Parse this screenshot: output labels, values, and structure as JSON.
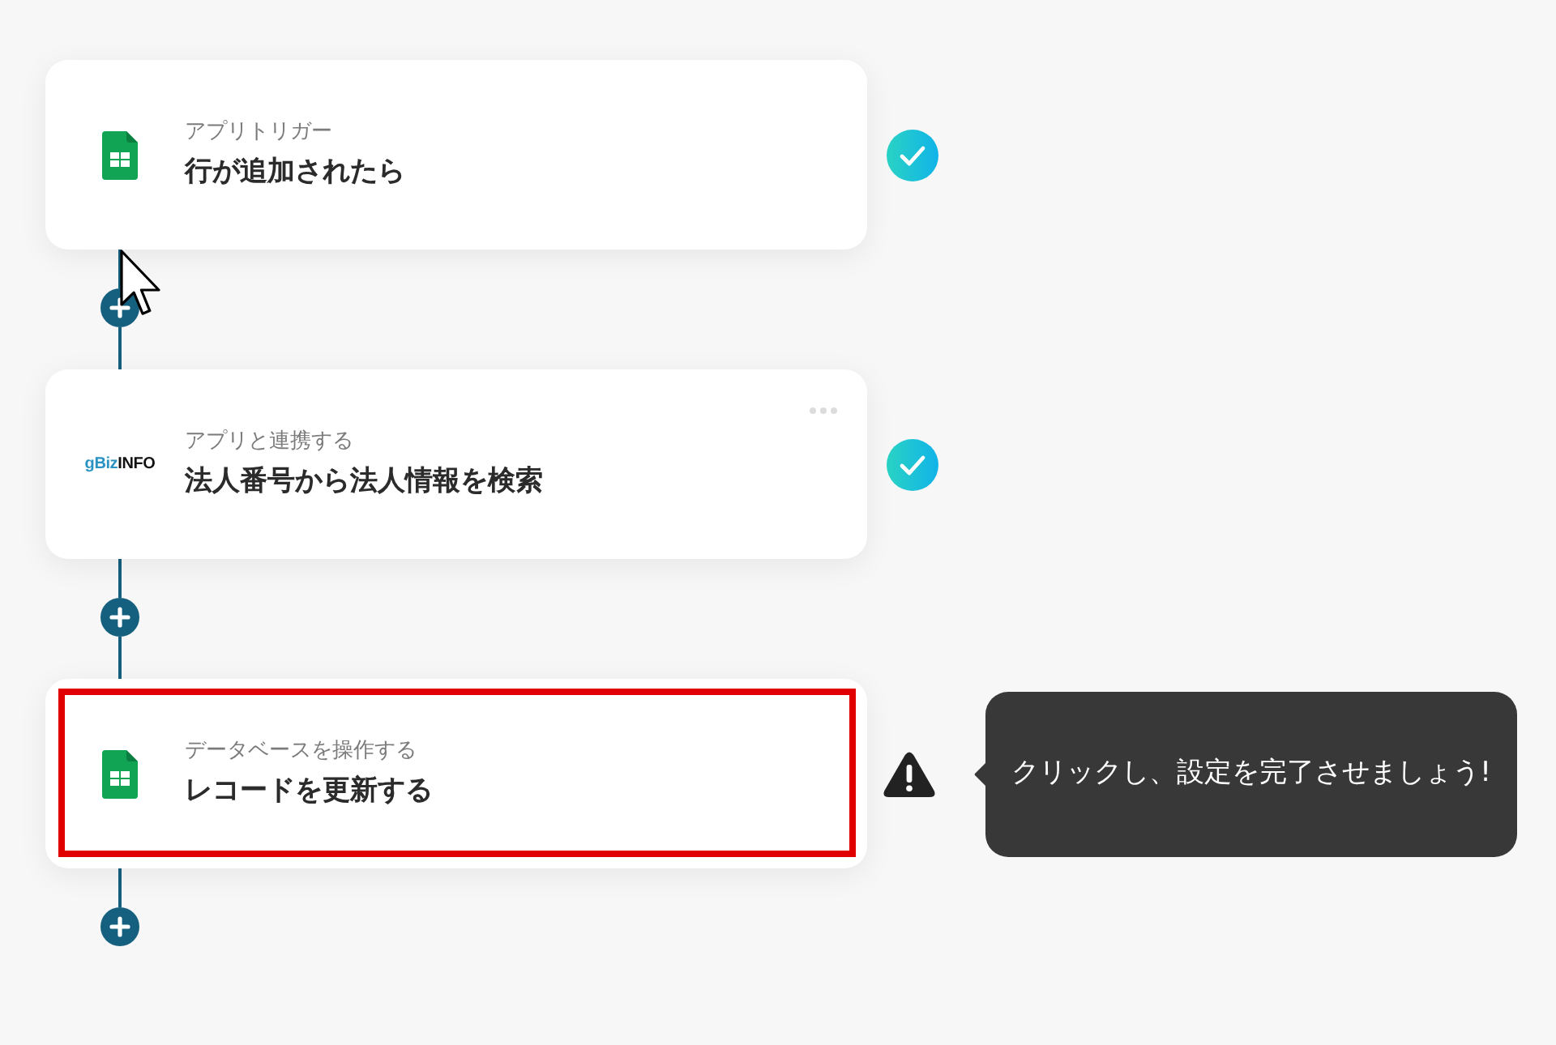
{
  "steps": [
    {
      "kind": "sheets",
      "label": "アプリトリガー",
      "title": "行が追加されたら",
      "completed": true,
      "highlighted": false,
      "menu_visible": false
    },
    {
      "kind": "wordmark",
      "logo": [
        "gBiz",
        "INFO"
      ],
      "label": "アプリと連携する",
      "title": "法人番号から法人情報を検索",
      "completed": true,
      "highlighted": false,
      "menu_visible": true
    },
    {
      "kind": "sheets",
      "label": "データベースを操作する",
      "title": "レコードを更新する",
      "completed": false,
      "highlighted": true,
      "menu_visible": false,
      "tooltip": "クリックし、設定を完了させましょう!"
    }
  ]
}
